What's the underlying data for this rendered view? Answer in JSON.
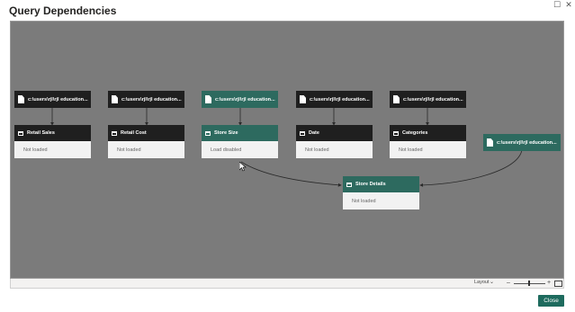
{
  "window": {
    "title": "Query Dependencies"
  },
  "sources": [
    {
      "label": "c:\\users\\rjl\\rjl education...",
      "highlighted": false
    },
    {
      "label": "c:\\users\\rjl\\rjl education...",
      "highlighted": false
    },
    {
      "label": "c:\\users\\rjl\\rjl education...",
      "highlighted": true
    },
    {
      "label": "c:\\users\\rjl\\rjl education...",
      "highlighted": false
    },
    {
      "label": "c:\\users\\rjl\\rjl education...",
      "highlighted": false
    },
    {
      "label": "c:\\users\\rjl\\rjl education...",
      "highlighted": true
    }
  ],
  "queries": [
    {
      "name": "Retail Sales",
      "status": "Not loaded",
      "highlighted": false
    },
    {
      "name": "Retail Cost",
      "status": "Not loaded",
      "highlighted": false
    },
    {
      "name": "Store Size",
      "status": "Load disabled",
      "highlighted": true
    },
    {
      "name": "Date",
      "status": "Not loaded",
      "highlighted": false
    },
    {
      "name": "Categories",
      "status": "Not loaded",
      "highlighted": false
    },
    {
      "name": "Store Details",
      "status": "Not loaded",
      "highlighted": true
    }
  ],
  "bottombar": {
    "layout_label": "Layout",
    "zoom_minus": "–",
    "zoom_plus": "+"
  },
  "footer": {
    "close_label": "Close"
  },
  "colors": {
    "canvas": "#7b7b7b",
    "node_dark": "#1f1f1f",
    "node_teal": "#2d6a5f",
    "close_button": "#1e6b5e"
  }
}
